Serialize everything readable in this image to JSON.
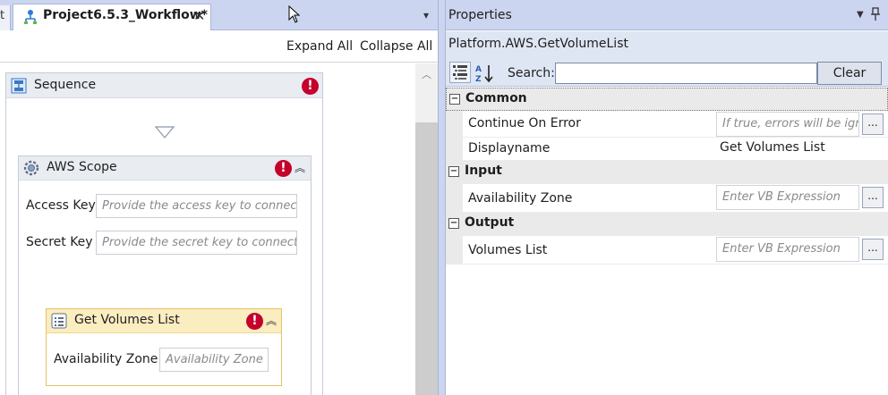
{
  "designer": {
    "prev_tab_fragment": "t",
    "active_tab": "Project6.5.3_Workflow*",
    "close_glyph": "✕",
    "menu_glyph": "▾",
    "expand_all": "Expand All",
    "collapse_all": "Collapse All",
    "sequence": {
      "title": "Sequence",
      "error_glyph": "!"
    },
    "aws_scope": {
      "title": "AWS Scope",
      "error_glyph": "!",
      "collapse_glyph": "︽",
      "access_key_label": "Access Key",
      "access_key_placeholder": "Provide the access key to connect",
      "secret_key_label": "Secret Key",
      "secret_key_placeholder": "Provide the secret key to connect"
    },
    "get_volumes": {
      "title": "Get Volumes List",
      "error_glyph": "!",
      "collapse_glyph": "︽",
      "az_label": "Availability Zone",
      "az_placeholder": "Availability Zone"
    }
  },
  "properties": {
    "title": "Properties",
    "dropdown_glyph": "▼",
    "pin_glyph": "📌",
    "object_name": "Platform.AWS.GetVolumeList",
    "search_label": "Search:",
    "search_value": "",
    "clear_label": "Clear",
    "categories": [
      {
        "name": "Common",
        "toggle": "−",
        "props": [
          {
            "name": "Continue On Error",
            "value": "",
            "placeholder": "If true, errors will be ignored",
            "has_button": true
          },
          {
            "name": "Displayname",
            "value": "Get Volumes List",
            "placeholder": "",
            "has_button": false
          }
        ]
      },
      {
        "name": "Input",
        "toggle": "−",
        "props": [
          {
            "name": "Availability Zone",
            "value": "",
            "placeholder": "Enter VB Expression",
            "has_button": true
          }
        ]
      },
      {
        "name": "Output",
        "toggle": "−",
        "props": [
          {
            "name": "Volumes List",
            "value": "",
            "placeholder": "Enter VB Expression",
            "has_button": true
          }
        ]
      }
    ],
    "ellipsis_label": "...",
    "icons": {
      "categorized": "categorized-view-icon",
      "alphabetical": "sort-az-icon"
    }
  },
  "colors": {
    "error": "#c4002b",
    "activity_header": "#faedc0",
    "tab_bar": "#ccd5f0"
  }
}
